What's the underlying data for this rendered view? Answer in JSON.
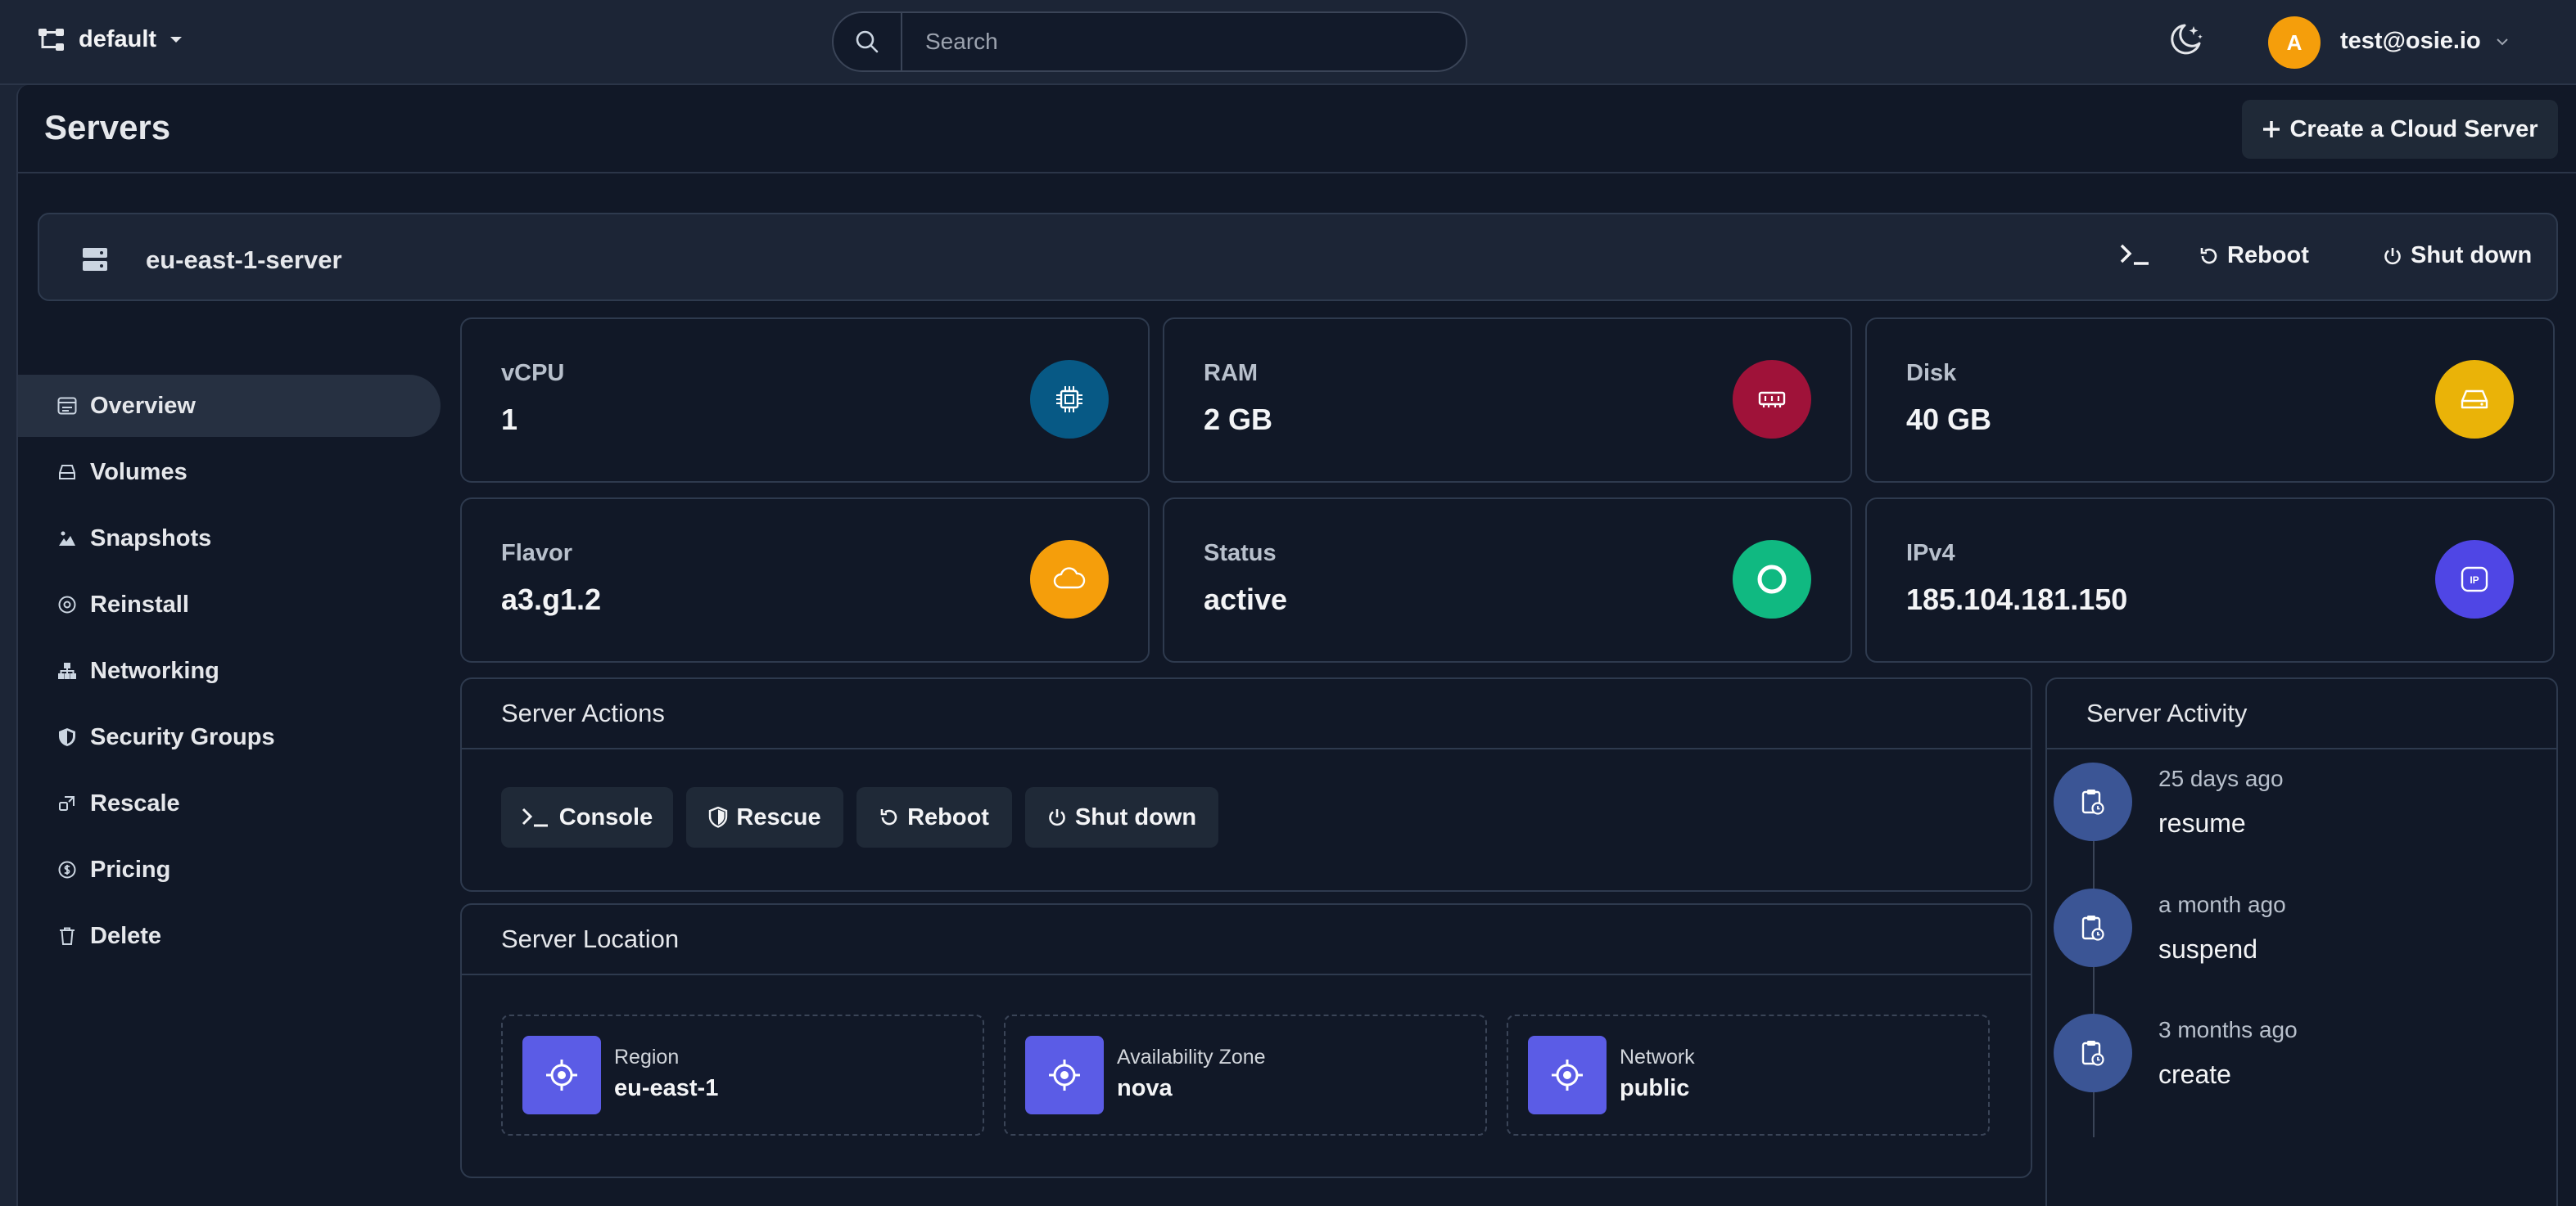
{
  "topbar": {
    "project": "default",
    "search_placeholder": "Search",
    "avatar_initial": "A",
    "user_email": "test@osie.io"
  },
  "page": {
    "title": "Servers",
    "create_label": "Create a Cloud Server"
  },
  "server": {
    "name": "eu-east-1-server",
    "reboot_label": "Reboot",
    "shutdown_label": "Shut down"
  },
  "nav": {
    "items": [
      {
        "label": "Overview",
        "icon": "overview-icon"
      },
      {
        "label": "Volumes",
        "icon": "volumes-icon"
      },
      {
        "label": "Snapshots",
        "icon": "snapshots-icon"
      },
      {
        "label": "Reinstall",
        "icon": "reinstall-icon"
      },
      {
        "label": "Networking",
        "icon": "networking-icon"
      },
      {
        "label": "Security Groups",
        "icon": "shield-icon"
      },
      {
        "label": "Rescale",
        "icon": "rescale-icon"
      },
      {
        "label": "Pricing",
        "icon": "dollar-icon"
      },
      {
        "label": "Delete",
        "icon": "trash-icon"
      }
    ],
    "active": "Overview"
  },
  "stats": {
    "vcpu": {
      "label": "vCPU",
      "value": "1",
      "color": "#075985"
    },
    "ram": {
      "label": "RAM",
      "value": "2 GB",
      "color": "#9f1239"
    },
    "disk": {
      "label": "Disk",
      "value": "40 GB",
      "color": "#eab308"
    },
    "flavor": {
      "label": "Flavor",
      "value": "a3.g1.2",
      "color": "#f59e0b"
    },
    "status": {
      "label": "Status",
      "value": "active",
      "color": "#10b981"
    },
    "ipv4": {
      "label": "IPv4",
      "value": "185.104.181.150",
      "color": "#4f46e5"
    }
  },
  "actions": {
    "title": "Server Actions",
    "console": "Console",
    "rescue": "Rescue",
    "reboot": "Reboot",
    "shutdown": "Shut down"
  },
  "location": {
    "title": "Server Location",
    "region_label": "Region",
    "region_value": "eu-east-1",
    "az_label": "Availability Zone",
    "az_value": "nova",
    "network_label": "Network",
    "network_value": "public"
  },
  "activity": {
    "title": "Server Activity",
    "items": [
      {
        "time": "25 days ago",
        "action": "resume"
      },
      {
        "time": "a month ago",
        "action": "suspend"
      },
      {
        "time": "3 months ago",
        "action": "create"
      }
    ]
  }
}
